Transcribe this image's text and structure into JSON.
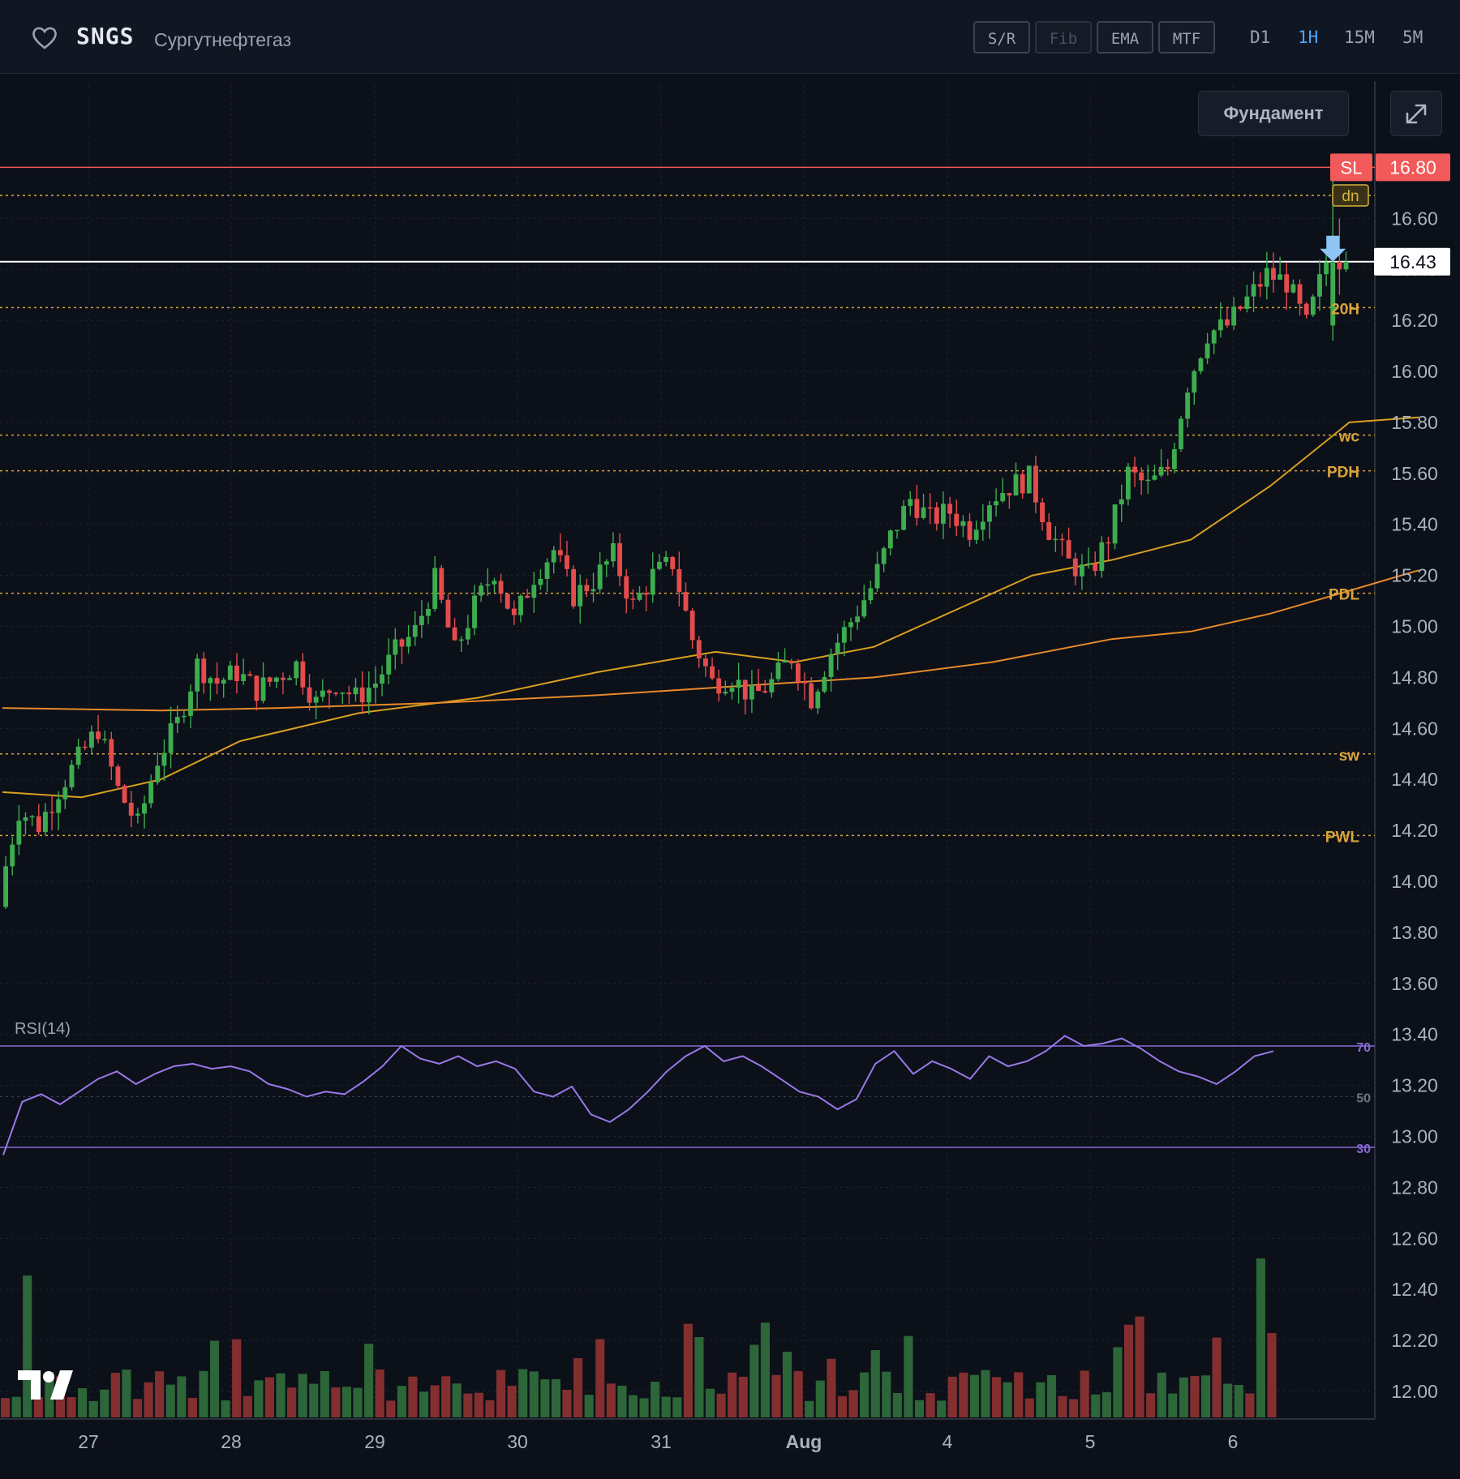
{
  "header": {
    "symbol": "SNGS",
    "company": "Сургутнефтегаз",
    "tools": [
      {
        "label": "S/R",
        "enabled": true
      },
      {
        "label": "Fib",
        "enabled": false
      },
      {
        "label": "EMA",
        "enabled": true
      },
      {
        "label": "MTF",
        "enabled": true
      }
    ],
    "timeframes": [
      {
        "label": "D1",
        "active": false
      },
      {
        "label": "1H",
        "active": true
      },
      {
        "label": "15M",
        "active": false
      },
      {
        "label": "5M",
        "active": false
      }
    ],
    "fundamental_label": "Фундамент",
    "active_color": "#4aa3ff"
  },
  "chart_data": {
    "type": "candlestick",
    "interval": "1H",
    "x_tick_labels": [
      "27",
      "28",
      "29",
      "30",
      "31",
      "Aug",
      "4",
      "5",
      "6"
    ],
    "y_ticks": [
      "12.00",
      "12.20",
      "12.40",
      "12.60",
      "12.80",
      "13.00",
      "13.20",
      "13.40",
      "13.60",
      "13.80",
      "14.00",
      "14.20",
      "14.40",
      "14.60",
      "14.80",
      "15.00",
      "15.20",
      "15.40",
      "15.60",
      "15.80",
      "16.00",
      "16.20",
      "16.40",
      "16.60",
      "16.80"
    ],
    "ylim": [
      11.9,
      16.95
    ],
    "grid": true,
    "current_price": "16.43",
    "close_path": [
      13.95,
      14.28,
      14.22,
      14.36,
      14.48,
      14.6,
      14.36,
      14.22,
      14.48,
      14.62,
      14.85,
      14.78,
      14.82,
      14.75,
      14.8,
      14.85,
      14.7,
      14.78,
      14.72,
      14.78,
      14.9,
      14.98,
      15.18,
      14.9,
      15.08,
      15.22,
      15.02,
      15.2,
      15.3,
      15.12,
      15.18,
      15.28,
      15.08,
      15.2,
      15.25,
      14.95,
      14.78,
      14.8,
      14.72,
      14.78,
      14.88,
      14.72,
      14.9,
      15.02,
      15.15,
      15.35,
      15.5,
      15.42,
      15.45,
      15.38,
      15.5,
      15.55,
      15.58,
      15.38,
      15.25,
      15.2,
      15.35,
      15.6,
      15.55,
      15.62,
      15.95,
      16.15,
      16.18,
      16.28,
      16.38,
      16.35,
      16.18,
      16.43
    ],
    "ema_fast": [
      [
        0,
        14.35
      ],
      [
        4,
        14.33
      ],
      [
        8,
        14.4
      ],
      [
        12,
        14.55
      ],
      [
        18,
        14.66
      ],
      [
        24,
        14.72
      ],
      [
        30,
        14.82
      ],
      [
        36,
        14.9
      ],
      [
        40,
        14.86
      ],
      [
        44,
        14.92
      ],
      [
        48,
        15.06
      ],
      [
        52,
        15.2
      ],
      [
        56,
        15.26
      ],
      [
        60,
        15.34
      ],
      [
        64,
        15.55
      ],
      [
        68,
        15.8
      ],
      [
        71.5,
        15.82
      ]
    ],
    "ema_slow": [
      [
        0,
        14.68
      ],
      [
        8,
        14.67
      ],
      [
        14,
        14.68
      ],
      [
        22,
        14.7
      ],
      [
        30,
        14.73
      ],
      [
        36,
        14.76
      ],
      [
        44,
        14.8
      ],
      [
        50,
        14.86
      ],
      [
        56,
        14.95
      ],
      [
        60,
        14.98
      ],
      [
        64,
        15.05
      ],
      [
        68,
        15.14
      ],
      [
        71.5,
        15.22
      ]
    ],
    "levels": [
      {
        "label": "SL",
        "price": "16.80",
        "style": "solid",
        "color": "#f05a5a",
        "badge": true
      },
      {
        "label": "dn",
        "price": 16.69,
        "style": "dotted",
        "color": "#d8b13b",
        "badge": true
      },
      {
        "label": "20H",
        "price": 16.25,
        "style": "dotted",
        "color": "#d8a43b"
      },
      {
        "label": "wc",
        "price": 15.75,
        "style": "dotted",
        "color": "#d8a43b"
      },
      {
        "label": "PDH",
        "price": 15.61,
        "style": "dotted",
        "color": "#d8a43b"
      },
      {
        "label": "PDL",
        "price": 15.13,
        "style": "dotted",
        "color": "#d8a43b"
      },
      {
        "label": "sw",
        "price": 14.5,
        "style": "dotted",
        "color": "#d8a43b"
      },
      {
        "label": "PWL",
        "price": 14.18,
        "style": "dotted",
        "color": "#d8a43b"
      }
    ],
    "rsi": {
      "label": "RSI(14)",
      "levels": [
        "70",
        "50",
        "30"
      ],
      "values": [
        27,
        48,
        51,
        47,
        52,
        57,
        60,
        55,
        59,
        62,
        63,
        61,
        62,
        60,
        55,
        53,
        50,
        52,
        51,
        56,
        62,
        70,
        65,
        63,
        66,
        62,
        64,
        61,
        52,
        50,
        54,
        43,
        40,
        45,
        52,
        60,
        66,
        70,
        64,
        66,
        62,
        57,
        52,
        50,
        45,
        49,
        63,
        68,
        59,
        64,
        61,
        57,
        66,
        62,
        64,
        68,
        74,
        70,
        71,
        73,
        69,
        64,
        60,
        58,
        55,
        60,
        66,
        68
      ]
    },
    "volume": {
      "bars": 116
    },
    "colors": {
      "up": "#3dac4f",
      "down": "#e34c4c",
      "ema_fast": "#d9a020",
      "ema_slow": "#e88a2a",
      "rsi": "#9a78e8",
      "rsi_levels": "#8a6ad8",
      "current_line": "#ffffff"
    }
  }
}
